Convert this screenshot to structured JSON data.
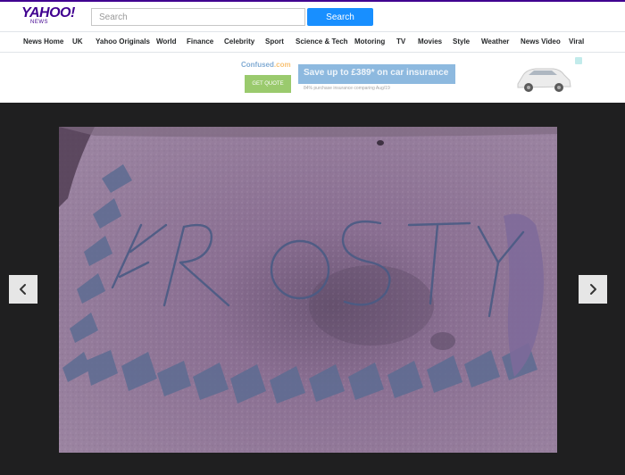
{
  "header": {
    "logo_main": "YAHOO!",
    "logo_sub": "NEWS",
    "search_placeholder": "Search",
    "search_button": "Search"
  },
  "nav": {
    "items": [
      {
        "label": "News Home"
      },
      {
        "label": "UK"
      },
      {
        "label": "Yahoo Originals"
      },
      {
        "label": "World"
      },
      {
        "label": "Finance"
      },
      {
        "label": "Celebrity"
      },
      {
        "label": "Sport"
      },
      {
        "label": "Science & Tech"
      },
      {
        "label": "Motoring"
      },
      {
        "label": "TV"
      },
      {
        "label": "Movies"
      },
      {
        "label": "Style"
      },
      {
        "label": "Weather"
      },
      {
        "label": "News Video"
      },
      {
        "label": "Viral"
      }
    ]
  },
  "ad": {
    "brand": "Confused",
    "brand_suffix": ".com",
    "headline": "Save up to £389* on car insurance",
    "subtext": "84% purchase insurance comparing Aug/19",
    "cta": "GET QUOTE"
  },
  "gallery": {
    "photo_text": "FROSTY",
    "prev_icon": "chevron-left-icon",
    "next_icon": "chevron-right-icon"
  },
  "colors": {
    "brand": "#400090",
    "search_button": "#188fff",
    "gallery_background": "#1f1f20",
    "photo_tint": "#8a6d91"
  }
}
